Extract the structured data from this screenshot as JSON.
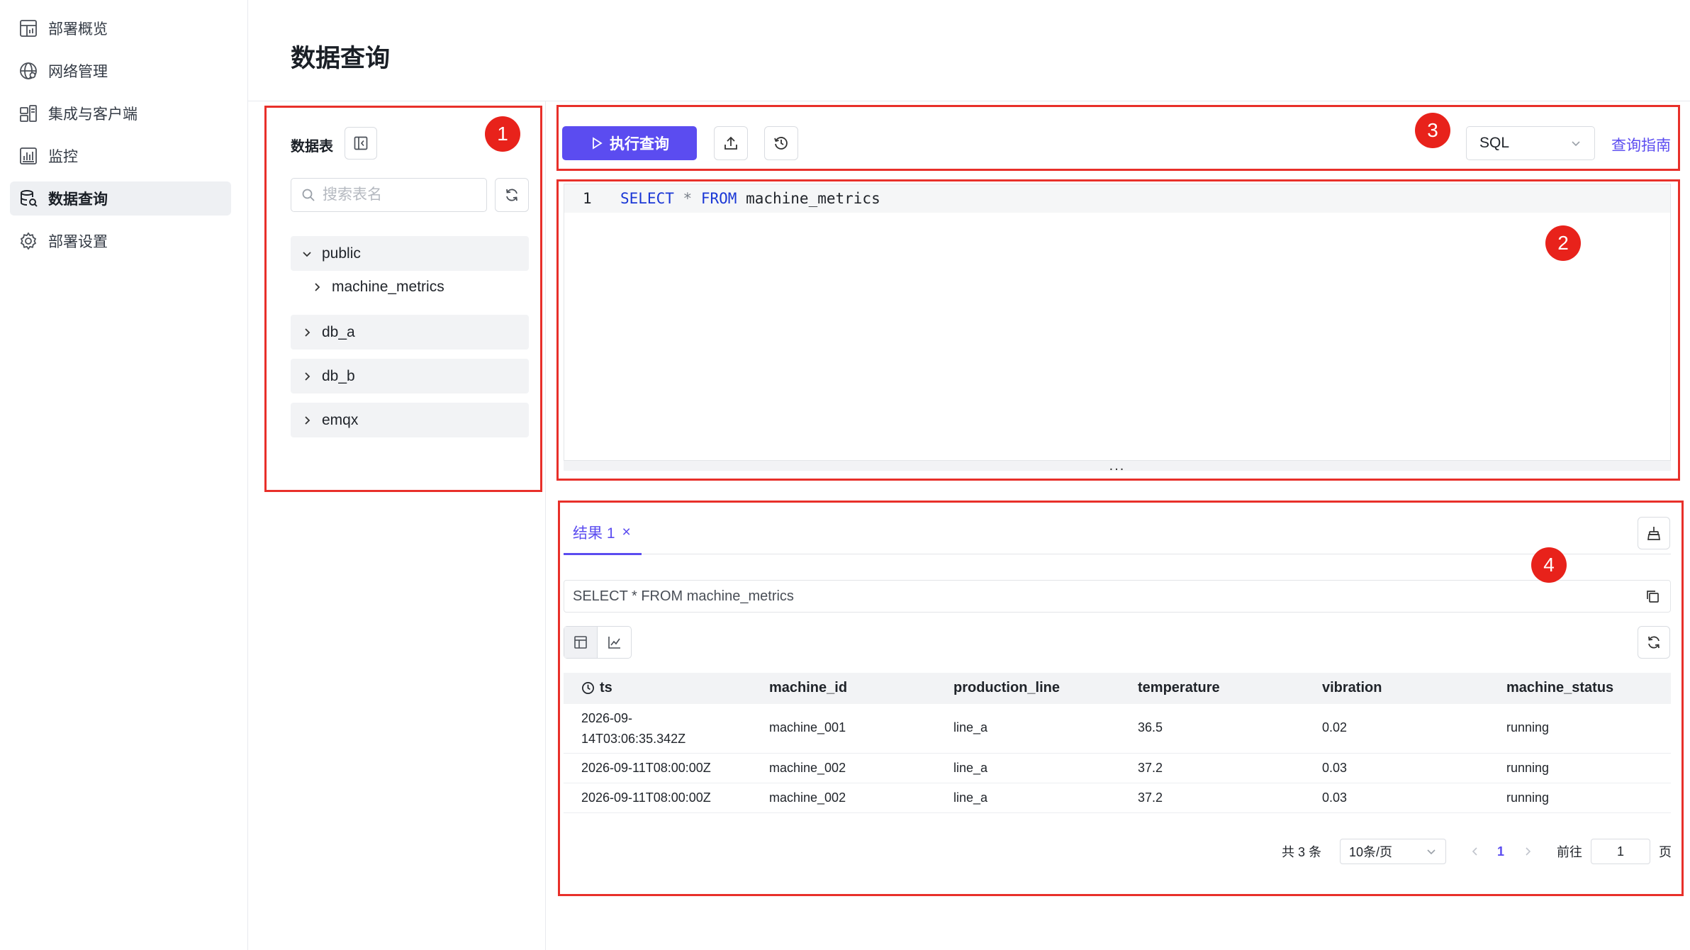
{
  "sidebar": {
    "items": [
      {
        "label": "部署概览",
        "icon": "dashboard-icon"
      },
      {
        "label": "网络管理",
        "icon": "globe-icon"
      },
      {
        "label": "集成与客户端",
        "icon": "integration-icon"
      },
      {
        "label": "监控",
        "icon": "chart-icon"
      },
      {
        "label": "数据查询",
        "icon": "database-search-icon",
        "active": true
      },
      {
        "label": "部署设置",
        "icon": "gear-icon"
      }
    ]
  },
  "page": {
    "title": "数据查询"
  },
  "tables_panel": {
    "title": "数据表",
    "search_placeholder": "搜索表名",
    "tree": [
      {
        "name": "public",
        "expanded": true,
        "children": [
          "machine_metrics"
        ]
      },
      {
        "name": "db_a",
        "expanded": false
      },
      {
        "name": "db_b",
        "expanded": false
      },
      {
        "name": "emqx",
        "expanded": false
      }
    ]
  },
  "toolbar": {
    "run_label": "执行查询",
    "language": "SQL",
    "guide_label": "查询指南"
  },
  "editor": {
    "line_number": "1",
    "tokens": {
      "select": "SELECT",
      "star": "*",
      "from": "FROM",
      "table": "machine_metrics"
    },
    "resize_handle": "..."
  },
  "results": {
    "tab_label": "结果 1",
    "tab_close": "×",
    "query_text": "SELECT * FROM machine_metrics",
    "columns": [
      "ts",
      "machine_id",
      "production_line",
      "temperature",
      "vibration",
      "machine_status"
    ],
    "rows": [
      [
        "2026-09-14T03:06:35.342Z",
        "machine_001",
        "line_a",
        "36.5",
        "0.02",
        "running"
      ],
      [
        "2026-09-11T08:00:00Z",
        "machine_002",
        "line_a",
        "37.2",
        "0.03",
        "running"
      ],
      [
        "2026-09-11T08:00:00Z",
        "machine_002",
        "line_a",
        "37.2",
        "0.03",
        "running"
      ]
    ],
    "row_0_ts_line1": "2026-09-",
    "row_0_ts_line2": "14T03:06:35.342Z"
  },
  "pagination": {
    "total": "共 3 条",
    "page_size": "10条/页",
    "current_page": "1",
    "goto_label": "前往",
    "goto_value": "1",
    "page_unit": "页"
  },
  "annotations": {
    "badge1": "1",
    "badge2": "2",
    "badge3": "3",
    "badge4": "4"
  },
  "colors": {
    "accent": "#5b4cf0",
    "annotation": "#e8302a"
  }
}
